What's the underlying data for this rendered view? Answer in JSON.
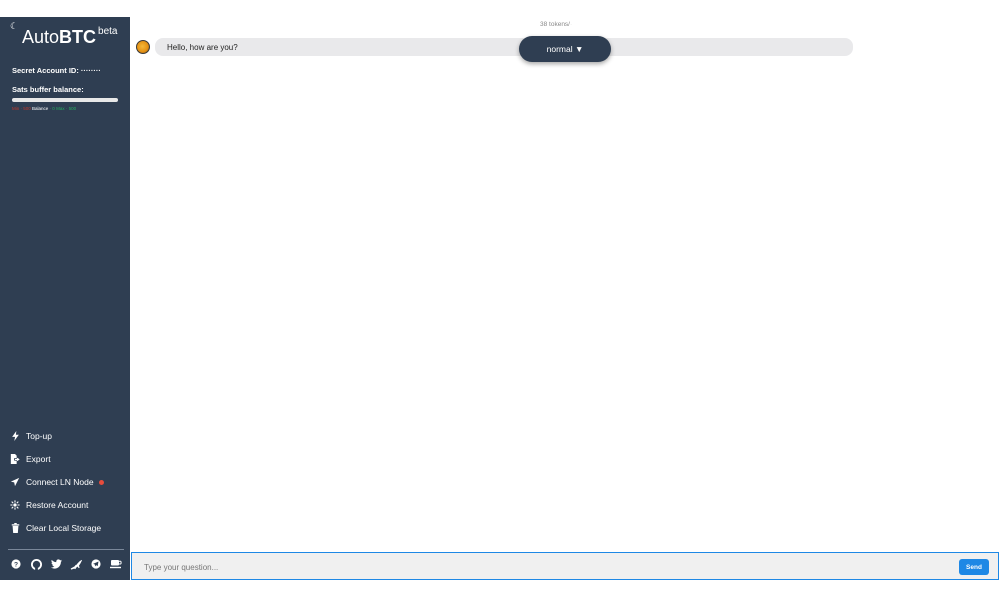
{
  "sidebar": {
    "logo_prefix": "Auto",
    "logo_bold": "BTC",
    "logo_badge": "beta",
    "secret_account_label": "Secret Account ID: ········",
    "sats_label": "Sats buffer balance:",
    "sats_buffer_fill": 0.0,
    "balance_min": "Min · 500",
    "balance_label": "Balance",
    "balance_value": "· 0",
    "balance_max": "Max · 500",
    "menu": [
      {
        "label": "Top-up",
        "icon": "lightning-icon"
      },
      {
        "label": "Export",
        "icon": "export-icon"
      },
      {
        "label": "Connect LN Node",
        "icon": "send-icon",
        "status": "offline"
      },
      {
        "label": "Restore Account",
        "icon": "restore-icon"
      },
      {
        "label": "Clear Local Storage",
        "icon": "trash-icon"
      }
    ],
    "social_icons": [
      "help-icon",
      "github-icon",
      "twitter-icon",
      "nostr-icon",
      "telegram-icon",
      "coffee-icon"
    ]
  },
  "main": {
    "tokens_label": "38 tokens/",
    "tokens_suffix": "·",
    "message": "Hello, how are you?",
    "mode_label": "normal ▼"
  },
  "input": {
    "placeholder": "Type your question...",
    "value": "",
    "send_label": "Send"
  },
  "colors": {
    "sidebar_bg": "#2f3e52",
    "accent": "#1e88e5",
    "status_dot": "#e74c3c"
  }
}
